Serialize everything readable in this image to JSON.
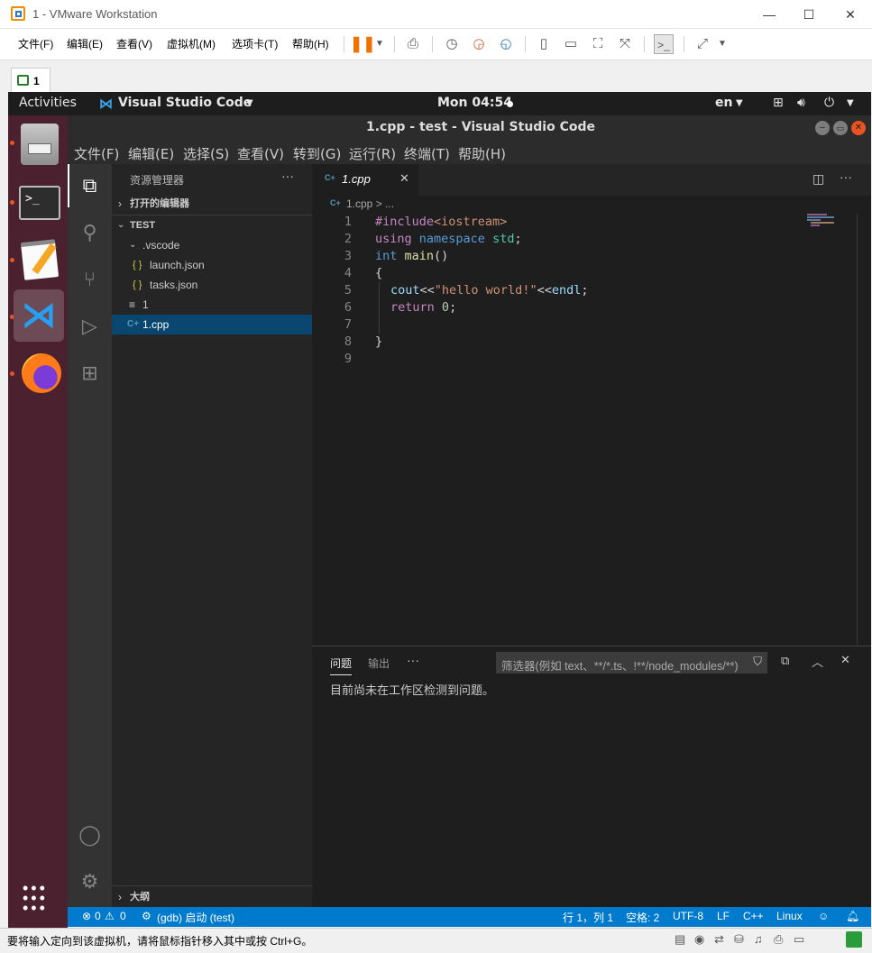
{
  "vmware": {
    "title": "1 - VMware Workstation",
    "menu": [
      "文件(F)",
      "编辑(E)",
      "查看(V)",
      "虚拟机(M)",
      "选项卡(T)",
      "帮助(H)"
    ],
    "tab_label": "1",
    "status_message": "要将输入定向到该虚拟机，请将鼠标指针移入其中或按 Ctrl+G。"
  },
  "ubuntu": {
    "activities": "Activities",
    "app_name": "Visual Studio Code",
    "clock": "Mon 04:54",
    "lang": "en"
  },
  "vscode": {
    "title": "1.cpp - test - Visual Studio Code",
    "menu": [
      "文件(F)",
      "编辑(E)",
      "选择(S)",
      "查看(V)",
      "转到(G)",
      "运行(R)",
      "终端(T)",
      "帮助(H)"
    ],
    "sidebar": {
      "header": "资源管理器",
      "open_editors": "打开的编辑器",
      "folder": "TEST",
      "items": [
        {
          "label": ".vscode"
        },
        {
          "label": "launch.json",
          "icon": "{ }"
        },
        {
          "label": "tasks.json",
          "icon": "{ }"
        },
        {
          "label": "1",
          "icon": "≡"
        },
        {
          "label": "1.cpp",
          "icon": "C+"
        }
      ],
      "outline": "大纲"
    },
    "tab": "1.cpp",
    "breadcrumb": "1.cpp > ...",
    "line_numbers": [
      "1",
      "2",
      "3",
      "4",
      "5",
      "6",
      "7",
      "8",
      "9"
    ],
    "code": {
      "l1_inc": "#include",
      "l1_hdr": "<iostream>",
      "l2_using": "using",
      "l2_ns": "namespace",
      "l2_std": "std",
      "l2_semi": ";",
      "l3_int": "int",
      "l3_main": "main",
      "l3_paren": "()",
      "l4": "{",
      "l5_cout": "cout",
      "l5_op1": "<<",
      "l5_str": "\"hello world!\"",
      "l5_op2": "<<",
      "l5_endl": "endl",
      "l5_semi": ";",
      "l6_ret": "return",
      "l6_zero": "0",
      "l6_semi": ";",
      "l8": "}"
    },
    "panel": {
      "tab_problems": "问题",
      "tab_output": "输出",
      "filter_placeholder": "筛选器(例如 text、**/*.ts、!**/node_modules/**)",
      "message": "目前尚未在工作区检测到问题。"
    },
    "status": {
      "errors": "0",
      "warnings": "0",
      "debug": "(gdb) 启动 (test)",
      "position": "行 1，列 1",
      "spaces": "空格: 2",
      "encoding": "UTF-8",
      "eol": "LF",
      "language": "C++",
      "os": "Linux"
    }
  },
  "colors": {
    "accent": "#007acc",
    "dock_bg": "#4b2130",
    "ubuntu_orange": "#e95420"
  }
}
